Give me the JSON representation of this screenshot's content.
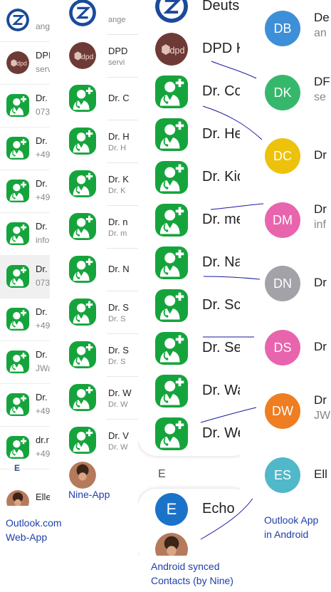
{
  "outlook_web": {
    "caption_lines": [
      "Outlook.com",
      "Web-App"
    ],
    "section_letter": "E",
    "contacts": [
      {
        "avatar": "zurich-logo-icon",
        "name": "",
        "sub": "ange"
      },
      {
        "avatar": "dpd-icon",
        "name": "DPI",
        "sub": "serv"
      },
      {
        "avatar": "doctor-icon",
        "name": "Dr.",
        "sub": "073"
      },
      {
        "avatar": "doctor-icon",
        "name": "Dr.",
        "sub": "+49"
      },
      {
        "avatar": "doctor-icon",
        "name": "Dr.",
        "sub": "+49"
      },
      {
        "avatar": "doctor-icon",
        "name": "Dr.",
        "sub": "info"
      },
      {
        "avatar": "doctor-icon",
        "name": "Dr.",
        "sub": "073"
      },
      {
        "avatar": "doctor-icon",
        "name": "Dr.",
        "sub": "+49"
      },
      {
        "avatar": "doctor-icon",
        "name": "Dr.",
        "sub": "JWa"
      },
      {
        "avatar": "doctor-icon",
        "name": "Dr.",
        "sub": "+49"
      },
      {
        "avatar": "doctor-icon",
        "name": "dr.r",
        "sub": "+49"
      }
    ],
    "last_contact": {
      "avatar": "photo-icon",
      "name": "Elle",
      "sub": ""
    }
  },
  "nine_app": {
    "caption": "Nine-App",
    "contacts": [
      {
        "avatar": "zurich-logo-icon",
        "name": "",
        "sub": "ange"
      },
      {
        "avatar": "dpd-icon",
        "name": "DPD",
        "sub": "servi"
      },
      {
        "avatar": "doctor-icon",
        "name": "Dr. C",
        "sub": ""
      },
      {
        "avatar": "doctor-icon",
        "name": "Dr. H",
        "sub": "Dr. H"
      },
      {
        "avatar": "doctor-icon",
        "name": "Dr. K",
        "sub": "Dr. K"
      },
      {
        "avatar": "doctor-icon",
        "name": "Dr. n",
        "sub": "Dr. m"
      },
      {
        "avatar": "doctor-icon",
        "name": "Dr. N",
        "sub": ""
      },
      {
        "avatar": "doctor-icon",
        "name": "Dr. S",
        "sub": "Dr. S"
      },
      {
        "avatar": "doctor-icon",
        "name": "Dr. S",
        "sub": "Dr. S"
      },
      {
        "avatar": "doctor-icon",
        "name": "Dr. W",
        "sub": "Dr. W"
      },
      {
        "avatar": "doctor-icon",
        "name": "Dr. V",
        "sub": "Dr. W"
      }
    ]
  },
  "android_contacts": {
    "caption_lines": [
      "Android synced",
      "Contacts (by Nine)"
    ],
    "section_letter": "E",
    "contacts": [
      {
        "avatar": "zurich-logo-icon",
        "name": "Deuts"
      },
      {
        "avatar": "dpd-icon",
        "name": "DPD K"
      },
      {
        "avatar": "doctor-icon",
        "name": "Dr. Co"
      },
      {
        "avatar": "doctor-icon",
        "name": "Dr. He"
      },
      {
        "avatar": "doctor-icon",
        "name": "Dr. Kic"
      },
      {
        "avatar": "doctor-icon",
        "name": "Dr. me"
      },
      {
        "avatar": "doctor-icon",
        "name": "Dr. Na"
      },
      {
        "avatar": "doctor-icon",
        "name": "Dr. Sc"
      },
      {
        "avatar": "doctor-icon",
        "name": "Dr. Se"
      },
      {
        "avatar": "doctor-icon",
        "name": "Dr. Wa"
      },
      {
        "avatar": "doctor-icon",
        "name": "Dr. We"
      }
    ],
    "echo_contact": {
      "initial": "E",
      "name": "Echo"
    }
  },
  "outlook_android": {
    "caption_lines": [
      "Outlook App",
      "in Android"
    ],
    "contacts": [
      {
        "initials": "DB",
        "color": "#3d8fd8",
        "name": "De",
        "sub": "an"
      },
      {
        "initials": "DK",
        "color": "#36b86c",
        "name": "DF",
        "sub": "se"
      },
      {
        "initials": "DC",
        "color": "#ecc20c",
        "name": "Dr",
        "sub": ""
      },
      {
        "initials": "DM",
        "color": "#e864ad",
        "name": "Dr",
        "sub": "inf"
      },
      {
        "initials": "DN",
        "color": "#a2a2a8",
        "name": "Dr",
        "sub": ""
      },
      {
        "initials": "DS",
        "color": "#e864ad",
        "name": "Dr",
        "sub": ""
      },
      {
        "initials": "DW",
        "color": "#ef7d22",
        "name": "Dr",
        "sub": "JW"
      },
      {
        "initials": "ES",
        "color": "#50b8c9",
        "name": "Ell",
        "sub": ""
      }
    ]
  },
  "colors": {
    "doctor_green": "#15a43c",
    "caption_blue": "#1f3fa8",
    "annotation_line": "#1a1aa0",
    "echo_avatar": "#1a73c9",
    "dpd_avatar": "#7b3f38"
  }
}
